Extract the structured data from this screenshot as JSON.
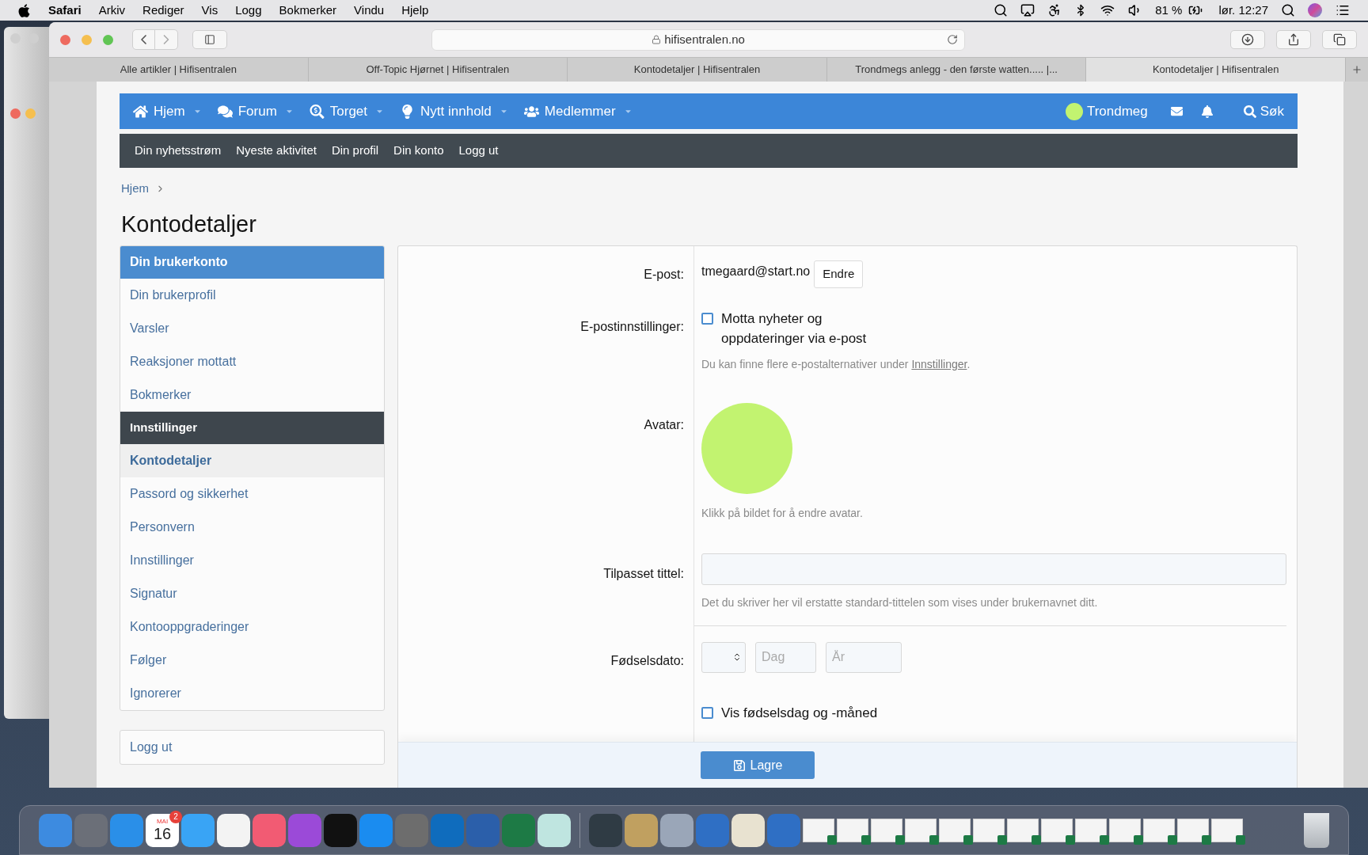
{
  "menubar": {
    "app": "Safari",
    "menus": [
      "Arkiv",
      "Rediger",
      "Vis",
      "Logg",
      "Bokmerker",
      "Vindu",
      "Hjelp"
    ],
    "battery": "81 %",
    "clock": "lør. 12:27"
  },
  "browser": {
    "url": "hifisentralen.no",
    "tabs": [
      {
        "title": "Alle artikler | Hifisentralen",
        "selected": false
      },
      {
        "title": "Off-Topic Hjørnet | Hifisentralen",
        "selected": false
      },
      {
        "title": "Kontodetaljer | Hifisentralen",
        "selected": false
      },
      {
        "title": "Trondmegs anlegg - den første watten..... |...",
        "selected": false
      },
      {
        "title": "Kontodetaljer | Hifisentralen",
        "selected": true
      }
    ]
  },
  "nav": {
    "items": [
      {
        "label": "Hjem"
      },
      {
        "label": "Forum"
      },
      {
        "label": "Torget"
      },
      {
        "label": "Nytt innhold"
      },
      {
        "label": "Medlemmer"
      }
    ],
    "user": "Trondmeg",
    "search": "Søk"
  },
  "subnav": [
    "Din nyhetsstrøm",
    "Nyeste aktivitet",
    "Din profil",
    "Din konto",
    "Logg ut"
  ],
  "breadcrumb": "Hjem",
  "page_title": "Kontodetaljer",
  "sidebar": {
    "items": [
      {
        "kind": "section",
        "label": "Din brukerkonto"
      },
      {
        "kind": "link",
        "label": "Din brukerprofil",
        "selected": false
      },
      {
        "kind": "link",
        "label": "Varsler",
        "selected": false
      },
      {
        "kind": "link",
        "label": "Reaksjoner mottatt",
        "selected": false
      },
      {
        "kind": "link",
        "label": "Bokmerker",
        "selected": false
      },
      {
        "kind": "heading",
        "label": "Innstillinger"
      },
      {
        "kind": "link",
        "label": "Kontodetaljer",
        "selected": true
      },
      {
        "kind": "link",
        "label": "Passord og sikkerhet",
        "selected": false
      },
      {
        "kind": "link",
        "label": "Personvern",
        "selected": false
      },
      {
        "kind": "link",
        "label": "Innstillinger",
        "selected": false
      },
      {
        "kind": "link",
        "label": "Signatur",
        "selected": false
      },
      {
        "kind": "link",
        "label": "Kontooppgraderinger",
        "selected": false
      },
      {
        "kind": "link",
        "label": "Følger",
        "selected": false
      },
      {
        "kind": "link",
        "label": "Ignorerer",
        "selected": false
      }
    ],
    "logout": "Logg ut"
  },
  "form": {
    "email": {
      "label": "E-post:",
      "value": "tmegaard@start.no",
      "button": "Endre"
    },
    "email_settings": {
      "label": "E-postinnstillinger:",
      "checkbox": {
        "label": "Motta nyheter og oppdateringer via e-post",
        "checked": false
      },
      "hint_before": "Du kan finne flere e-postalternativer under ",
      "hint_link": "Innstillinger",
      "hint_after": "."
    },
    "avatar": {
      "label": "Avatar:",
      "hint": "Klikk på bildet for å endre avatar."
    },
    "custom_title": {
      "label": "Tilpasset tittel:",
      "hint": "Det du skriver her vil erstatte standard-tittelen som vises under brukernavnet ditt."
    },
    "birthday": {
      "label": "Fødselsdato:",
      "day_placeholder": "Dag",
      "year_placeholder": "År",
      "checkbox": {
        "label": "Vis fødselsdag og -måned",
        "checked": false
      }
    },
    "save": "Lagre"
  },
  "dock": {
    "calendar": {
      "month": "MAI",
      "day": "16",
      "badge": "2"
    }
  }
}
